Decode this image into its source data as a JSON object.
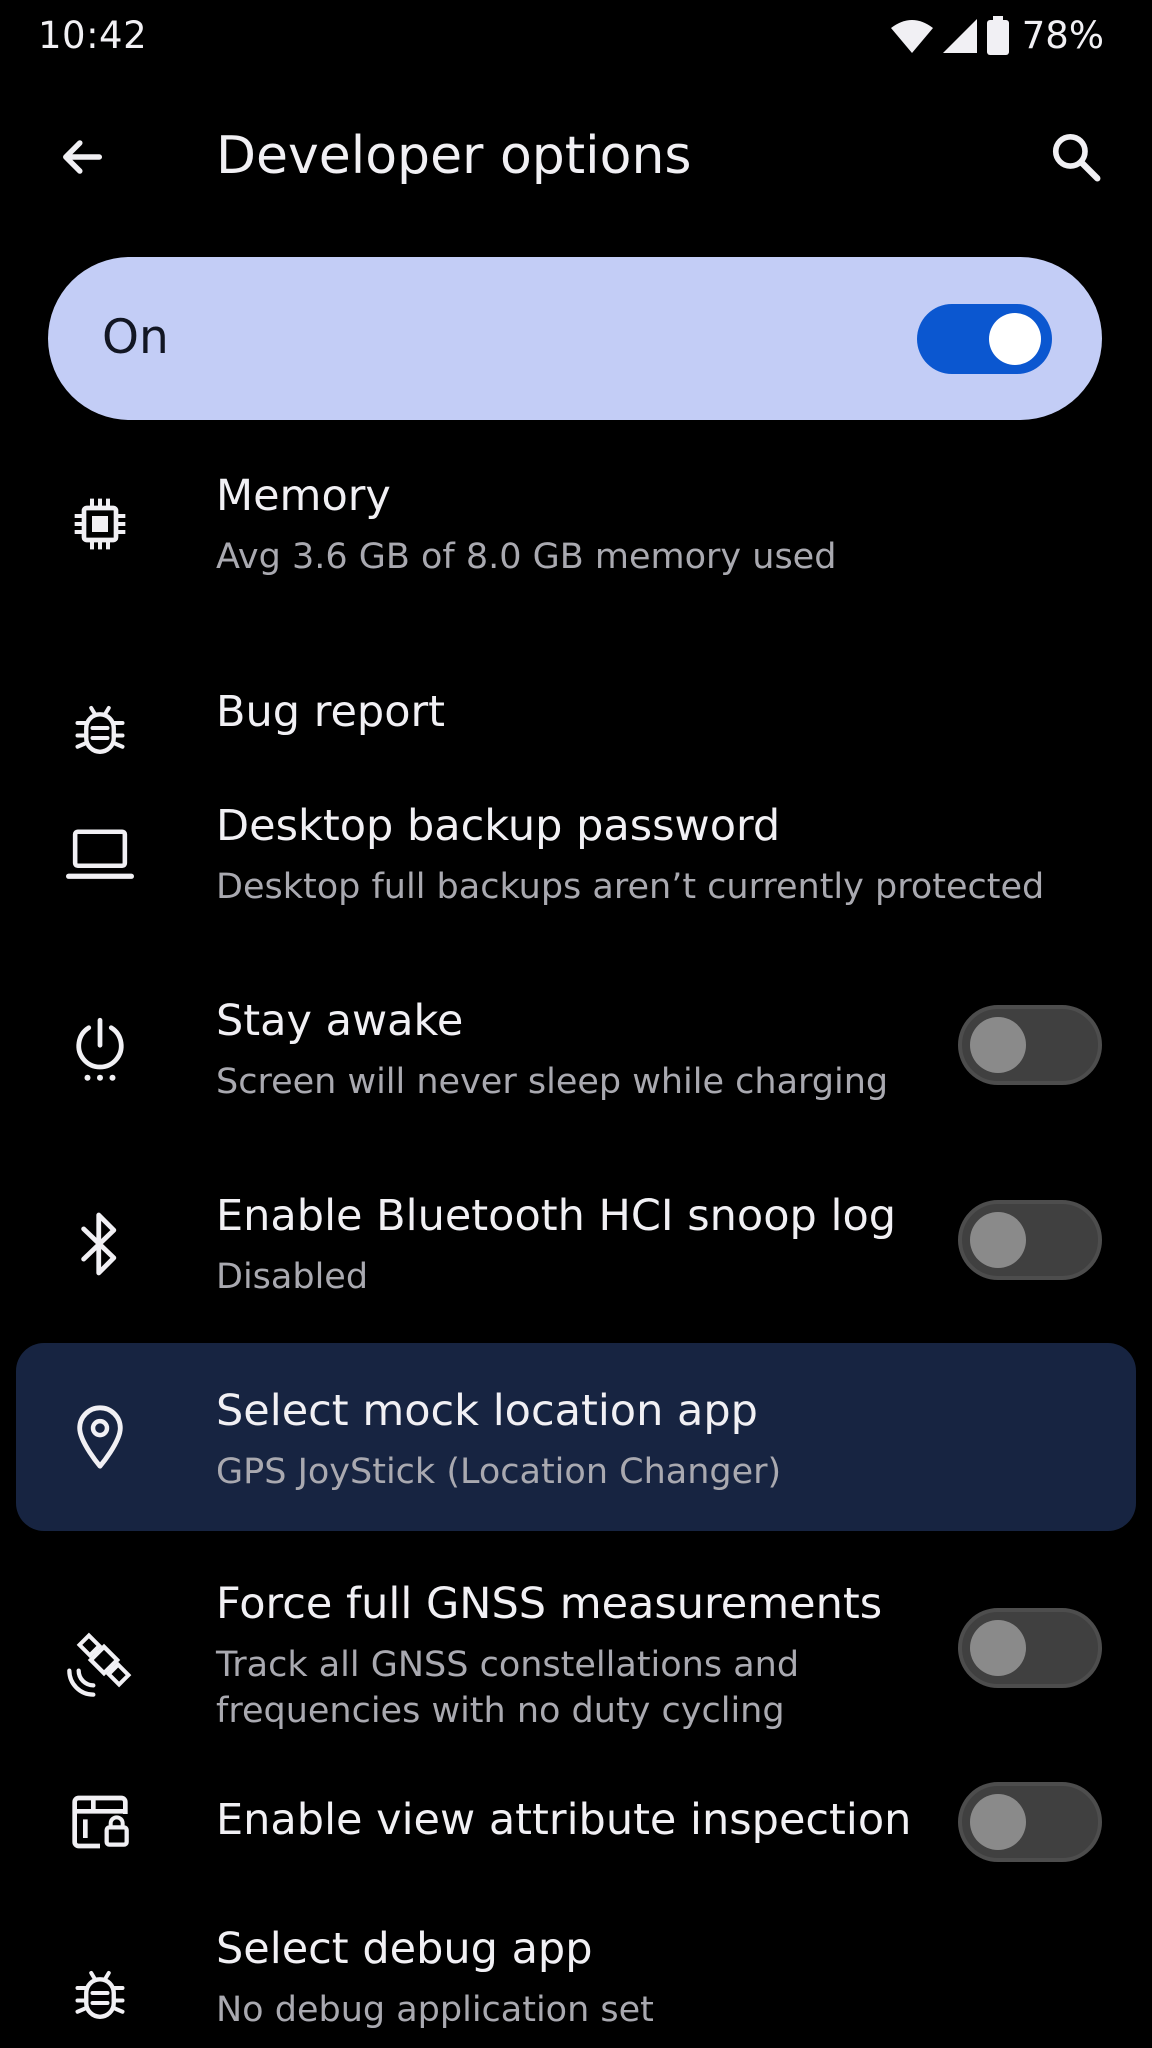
{
  "status_bar": {
    "time": "10:42",
    "battery_percent_label": "78%",
    "icons": [
      "wifi-icon",
      "cellular-signal-icon",
      "battery-icon"
    ]
  },
  "app_bar": {
    "title": "Developer options",
    "back_icon": "arrow-back-icon",
    "search_icon": "search-icon"
  },
  "master_switch": {
    "label": "On",
    "checked": true
  },
  "settings": [
    {
      "icon": "memory-chip-icon",
      "title": "Memory",
      "subtitle": "Avg 3.6 GB of 8.0 GB memory used"
    },
    {
      "icon": "bug-icon",
      "title": "Bug report"
    },
    {
      "icon": "laptop-icon",
      "title": "Desktop backup password",
      "subtitle": "Desktop full backups aren’t currently protected"
    },
    {
      "icon": "power-icon",
      "title": "Stay awake",
      "subtitle": "Screen will never sleep while charging",
      "toggle": false
    },
    {
      "icon": "bluetooth-icon",
      "title": "Enable Bluetooth HCI snoop log",
      "subtitle": "Disabled",
      "toggle": false
    },
    {
      "icon": "location-pin-icon",
      "title": "Select mock location app",
      "subtitle": "GPS JoyStick (Location Changer)",
      "highlighted": true
    },
    {
      "icon": "satellite-icon",
      "title": "Force full GNSS measurements",
      "subtitle_line1": "Track all GNSS constellations and",
      "subtitle_line2": "frequencies with no duty cycling",
      "toggle": false
    },
    {
      "icon": "view-inspection-icon",
      "title": "Enable view attribute inspection",
      "toggle": false
    },
    {
      "icon": "bug-icon",
      "title": "Select debug app",
      "subtitle": "No debug application set"
    }
  ],
  "colors": {
    "background": "#000000",
    "master_switch_bg": "#c3cdf6",
    "switch_on": "#0b57d0",
    "highlight_row_bg": "#172441",
    "text_primary": "#f1f0f4",
    "text_secondary": "#a9a9b0"
  }
}
